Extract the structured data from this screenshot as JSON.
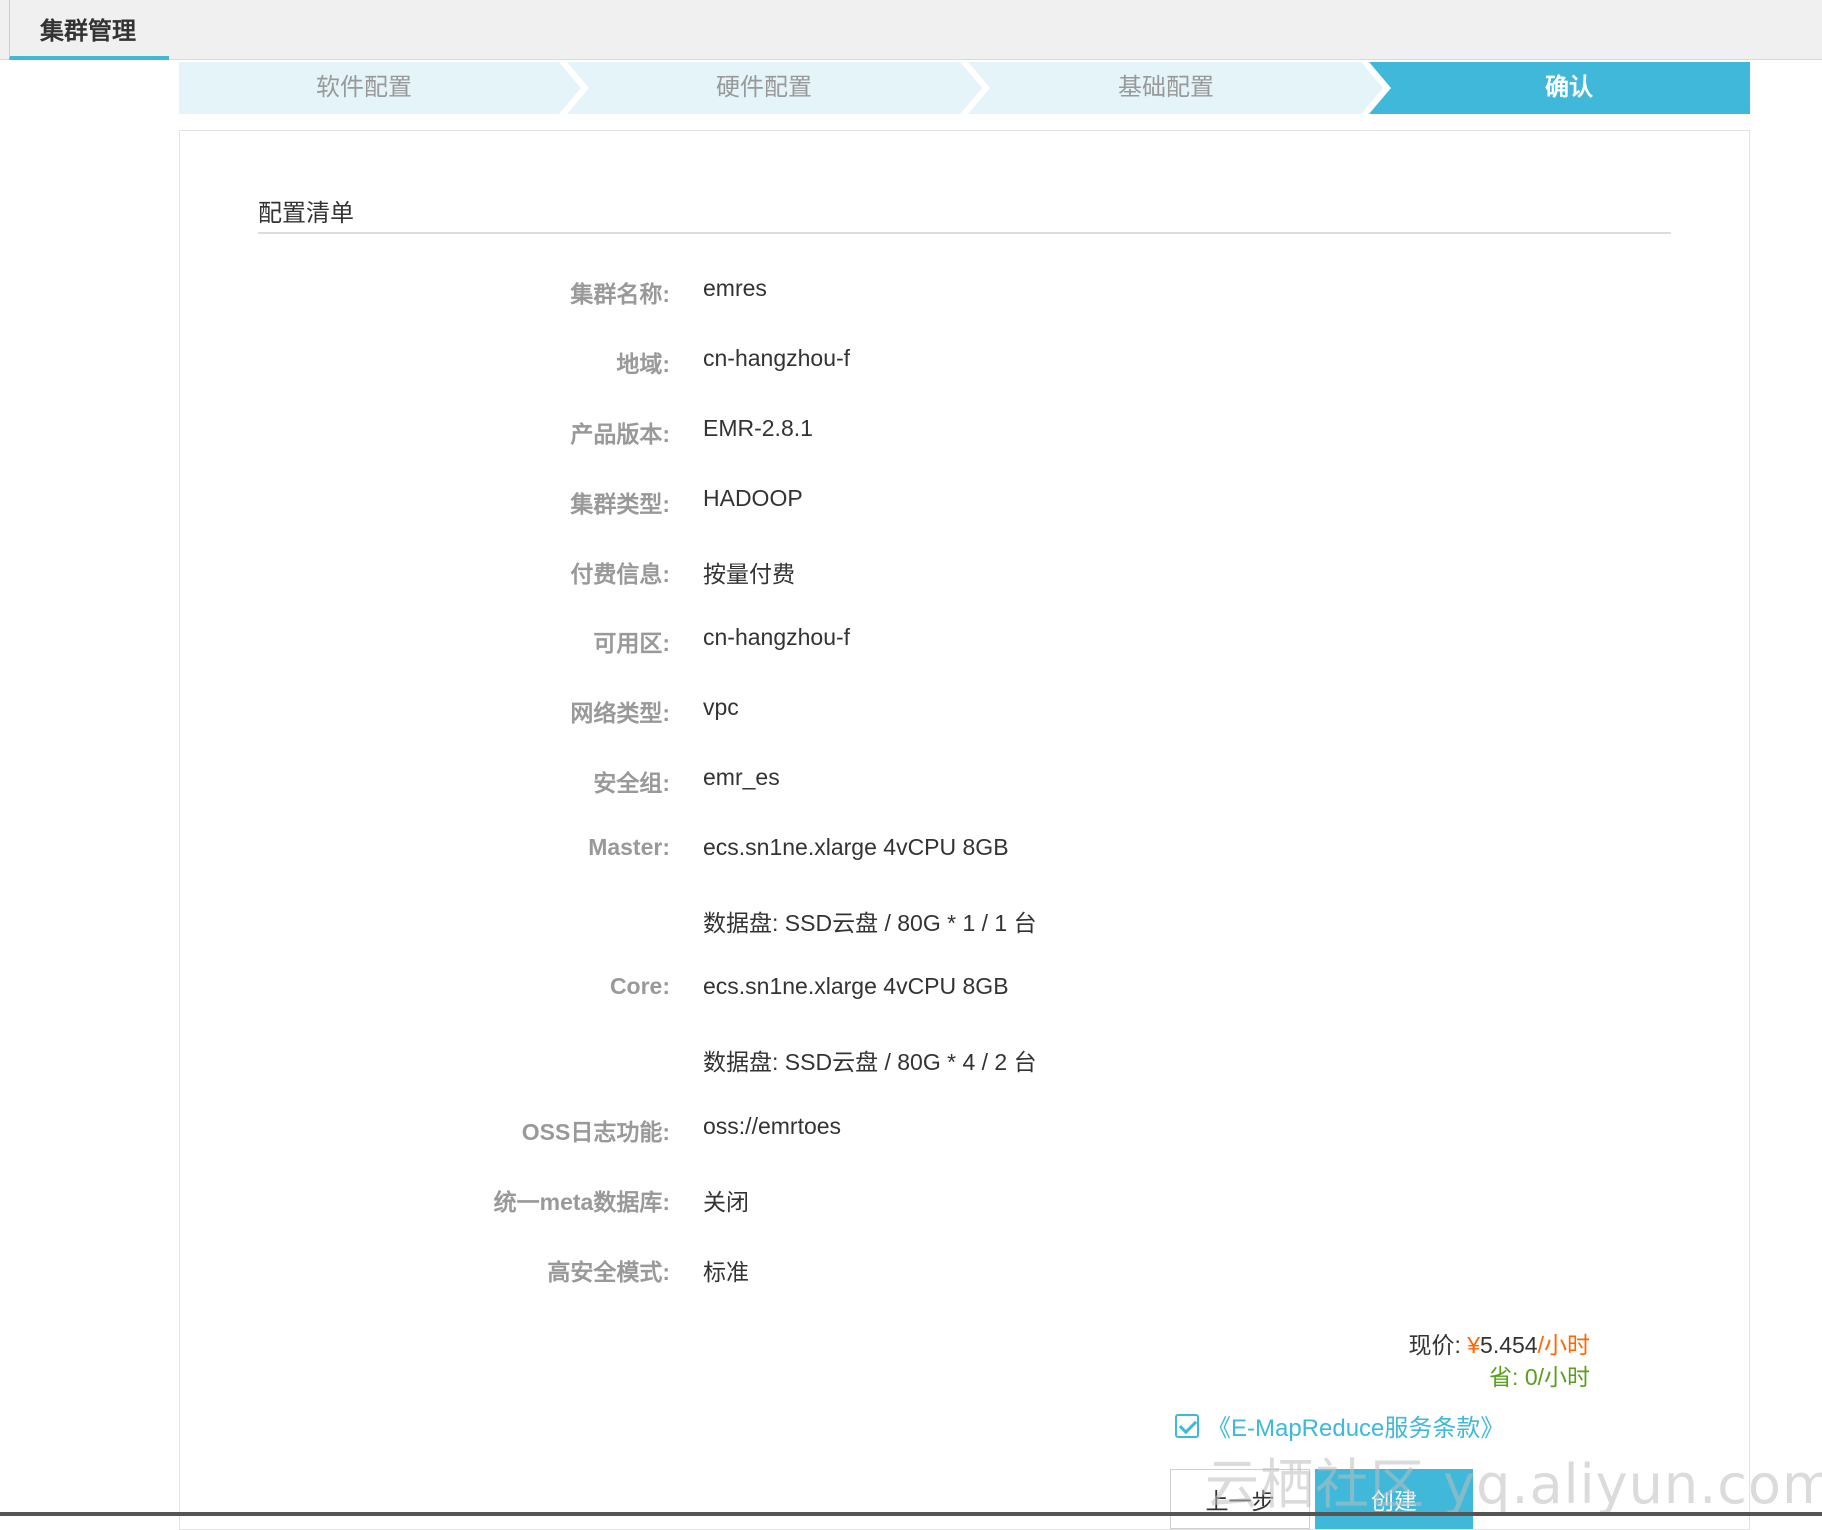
{
  "header": {
    "tab_label": "集群管理"
  },
  "steps": [
    {
      "label": "软件配置",
      "active": false
    },
    {
      "label": "硬件配置",
      "active": false
    },
    {
      "label": "基础配置",
      "active": false
    },
    {
      "label": "确认",
      "active": true
    }
  ],
  "colors": {
    "accent": "#3fb8d9",
    "step_inactive": "#e4f4f9",
    "price": "#ff6600",
    "save": "#5a9e1c"
  },
  "section": {
    "title": "配置清单"
  },
  "summary": [
    {
      "label": "集群名称:",
      "value": "emres"
    },
    {
      "label": "地域:",
      "value": "cn-hangzhou-f"
    },
    {
      "label": "产品版本:",
      "value": "EMR-2.8.1"
    },
    {
      "label": "集群类型:",
      "value": "HADOOP"
    },
    {
      "label": "付费信息:",
      "value": "按量付费"
    },
    {
      "label": "可用区:",
      "value": "cn-hangzhou-f"
    },
    {
      "label": "网络类型:",
      "value": "vpc"
    },
    {
      "label": "安全组:",
      "value": "emr_es"
    },
    {
      "label": "Master:",
      "value": "ecs.sn1ne.xlarge 4vCPU 8GB"
    },
    {
      "label": "",
      "value": "数据盘:  SSD云盘 / 80G * 1 / 1 台"
    },
    {
      "label": "Core:",
      "value": "ecs.sn1ne.xlarge 4vCPU 8GB"
    },
    {
      "label": "",
      "value": "数据盘:  SSD云盘 / 80G * 4 / 2 台"
    },
    {
      "label": "OSS日志功能:",
      "value": "oss://emrtoes"
    },
    {
      "label": "统一meta数据库:",
      "value": "关闭"
    },
    {
      "label": "高安全模式:",
      "value": "标准"
    }
  ],
  "pricing": {
    "current_label": "现价:",
    "currency": "¥",
    "amount": "5.454",
    "unit": "/小时",
    "save_label": "省:",
    "save_value": "0/小时"
  },
  "terms": {
    "label": "《E-MapReduce服务条款》",
    "checked": true
  },
  "buttons": {
    "prev": "上一步",
    "create": "创建"
  },
  "watermark": "云栖社区 yq.aliyun.com"
}
